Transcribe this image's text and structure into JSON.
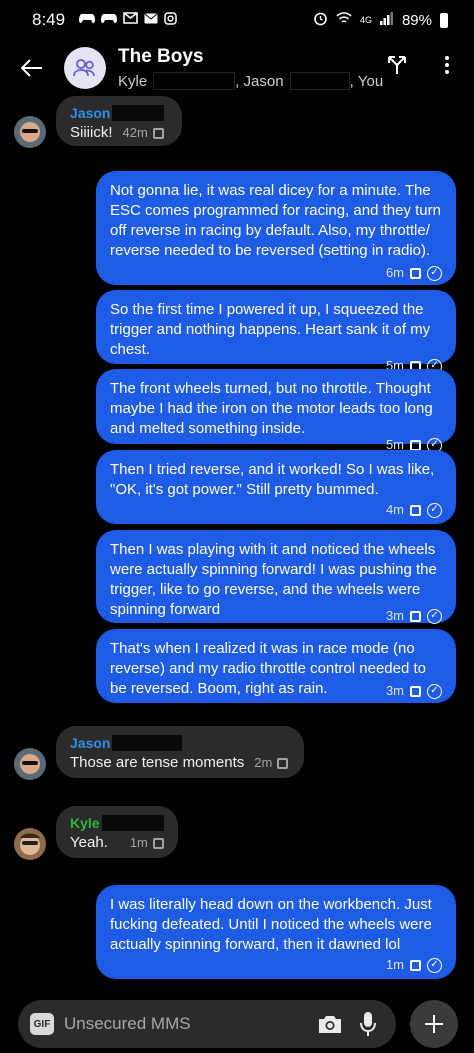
{
  "status_bar": {
    "time": "8:49",
    "network": "4G",
    "battery": "89%"
  },
  "header": {
    "title": "The Boys",
    "participants": [
      "Kyle",
      "Jason",
      "You"
    ]
  },
  "messages_in_top": {
    "sender": "Jason",
    "text": "Siiiick!",
    "time": "42m",
    "sender_color": "#2e8fe6"
  },
  "messages_out": [
    {
      "text": "Not gonna lie, it was real dicey for a minute. The ESC comes programmed for racing, and they turn off reverse in racing by default. Also, my throttle/ reverse needed to be reversed (setting in radio).",
      "time": "6m"
    },
    {
      "text": "So the first time I powered it up, I squeezed the trigger and nothing happens. Heart sank it of my chest.",
      "time": "5m"
    },
    {
      "text": "The front wheels turned, but no throttle. Thought maybe I had the iron on the motor leads too long and melted something inside.",
      "time": "5m"
    },
    {
      "text": "Then I tried reverse, and it worked! So I was like, \"OK, it's got power.\" Still pretty bummed.",
      "time": "4m"
    },
    {
      "text": "Then I was playing with it and noticed the wheels were actually spinning forward! I was pushing the trigger, like to go reverse, and the wheels were spinning forward",
      "time": "3m"
    },
    {
      "text": "That's when I realized it was in race mode (no reverse) and my radio throttle control needed to be reversed. Boom, right as rain.",
      "time": "3m"
    }
  ],
  "messages_in": [
    {
      "sender": "Jason",
      "text": "Those are tense moments",
      "time": "2m",
      "sender_color": "#2e8fe6"
    },
    {
      "sender": "Kyle",
      "text": "Yeah.",
      "time": "1m",
      "sender_color": "#2fb43a"
    }
  ],
  "last_out": {
    "text": "I was literally head down on the workbench. Just fucking defeated. Until I noticed the wheels were actually spinning forward, then it dawned lol",
    "time": "1m"
  },
  "composer": {
    "gif_label": "GIF",
    "placeholder": "Unsecured MMS"
  },
  "colors": {
    "outgoing_bubble": "#1f5ce5",
    "incoming_bubble": "#2b2b2b",
    "background": "#000000"
  }
}
